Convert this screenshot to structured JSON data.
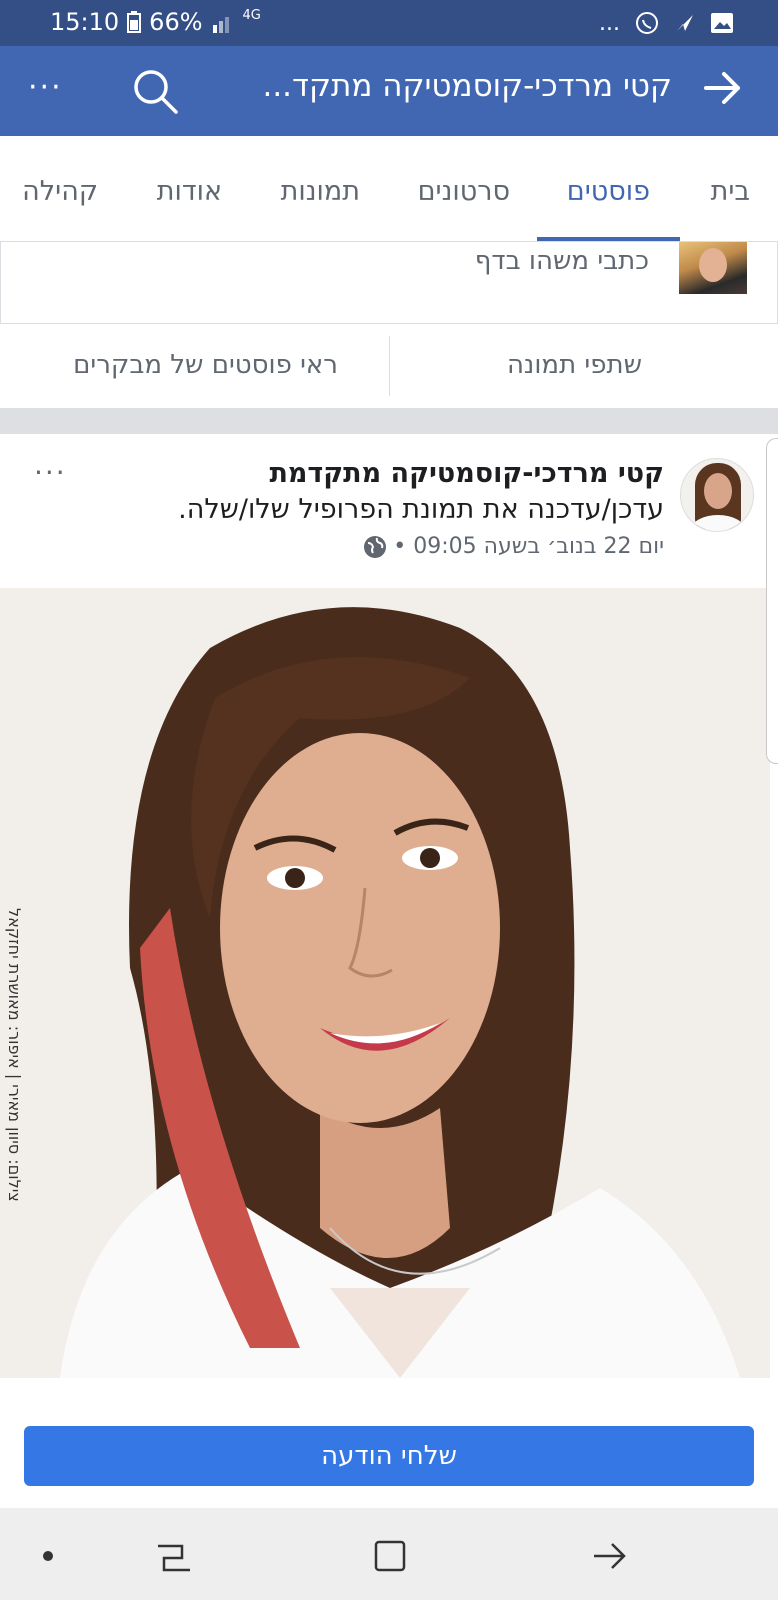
{
  "status_bar": {
    "time": "15:10",
    "battery": "66%",
    "network": "4G",
    "overflow": "..."
  },
  "app_bar": {
    "title": "קטי מרדכי-קוסמטיקה מתקד..."
  },
  "tabs": [
    {
      "label": "בית"
    },
    {
      "label": "פוסטים"
    },
    {
      "label": "סרטונים"
    },
    {
      "label": "תמונות"
    },
    {
      "label": "אודות"
    },
    {
      "label": "קהילה"
    }
  ],
  "composer": {
    "placeholder": "כתבי משהו בדף"
  },
  "actions": {
    "share_photo": "שתפי תמונה",
    "visitor_posts": "ראי פוסטים של מבקרים"
  },
  "post": {
    "author": "קטי מרדכי-קוסמטיקה מתקדמת",
    "action_text": "עדכן/עדכנה את תמונת הפרופיל שלו/שלה.",
    "timestamp": "יום 22 בנוב׳ בשעה 09:05 •",
    "photo_credit": "צילום: סיוון מאירי | איפור: מאושרת יחזקאל",
    "more": "···"
  },
  "send_message": {
    "label": "שלחי הודעה"
  },
  "colors": {
    "brand": "#4267b2",
    "status_bar": "#344e86",
    "button": "#3578e5"
  }
}
